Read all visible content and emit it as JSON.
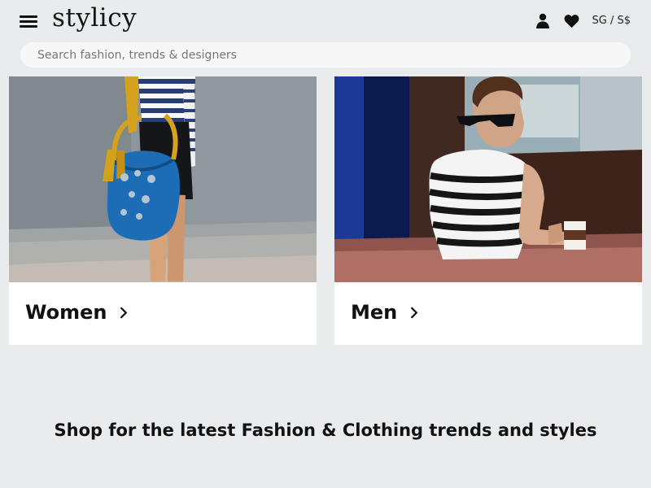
{
  "header": {
    "logo": "stylicy",
    "menu_icon": "hamburger-menu-icon",
    "account_icon": "user-icon",
    "wishlist_icon": "heart-icon",
    "region_label": "SG / S$"
  },
  "search": {
    "placeholder": "Search fashion, trends & designers",
    "value": "",
    "icon": "none"
  },
  "categories": [
    {
      "label": "Women",
      "icon": "chevron-right-icon"
    },
    {
      "label": "Men",
      "icon": "chevron-right-icon"
    }
  ],
  "tagline": "Shop for the latest Fashion & Clothing trends and styles",
  "colors": {
    "page_background": "#e9ebed",
    "card_background": "#ffffff",
    "text": "#111111",
    "search_background": "#f7f7f7",
    "women_bag": "#1c6db6",
    "women_handle": "#d3a417",
    "men_shirt_stripes": "#111111"
  }
}
